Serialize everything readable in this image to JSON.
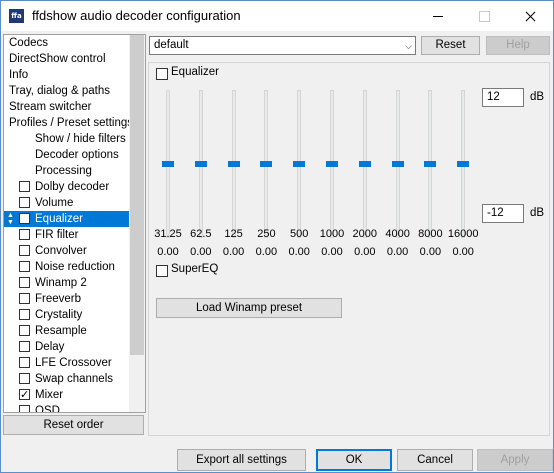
{
  "window": {
    "title": "ffdshow audio decoder configuration",
    "app_icon_text": "ffa",
    "accent": "#0078d7"
  },
  "tree": {
    "items": [
      {
        "label": "Codecs",
        "indent": 0,
        "checkbox": false,
        "checked": false,
        "selected": false
      },
      {
        "label": "DirectShow control",
        "indent": 0,
        "checkbox": false,
        "checked": false,
        "selected": false
      },
      {
        "label": "Info",
        "indent": 0,
        "checkbox": false,
        "checked": false,
        "selected": false
      },
      {
        "label": "Tray, dialog & paths",
        "indent": 0,
        "checkbox": false,
        "checked": false,
        "selected": false
      },
      {
        "label": "Stream switcher",
        "indent": 0,
        "checkbox": false,
        "checked": false,
        "selected": false
      },
      {
        "label": "Profiles / Preset settings",
        "indent": 0,
        "checkbox": false,
        "checked": false,
        "selected": false
      },
      {
        "label": "Show / hide filters",
        "indent": 2,
        "checkbox": false,
        "checked": false,
        "selected": false
      },
      {
        "label": "Decoder options",
        "indent": 2,
        "checkbox": false,
        "checked": false,
        "selected": false
      },
      {
        "label": "Processing",
        "indent": 2,
        "checkbox": false,
        "checked": false,
        "selected": false
      },
      {
        "label": "Dolby decoder",
        "indent": 1,
        "checkbox": true,
        "checked": false,
        "selected": false
      },
      {
        "label": "Volume",
        "indent": 1,
        "checkbox": true,
        "checked": false,
        "selected": false
      },
      {
        "label": "Equalizer",
        "indent": 1,
        "checkbox": true,
        "checked": false,
        "selected": true
      },
      {
        "label": "FIR filter",
        "indent": 1,
        "checkbox": true,
        "checked": false,
        "selected": false
      },
      {
        "label": "Convolver",
        "indent": 1,
        "checkbox": true,
        "checked": false,
        "selected": false
      },
      {
        "label": "Noise reduction",
        "indent": 1,
        "checkbox": true,
        "checked": false,
        "selected": false
      },
      {
        "label": "Winamp 2",
        "indent": 1,
        "checkbox": true,
        "checked": false,
        "selected": false
      },
      {
        "label": "Freeverb",
        "indent": 1,
        "checkbox": true,
        "checked": false,
        "selected": false
      },
      {
        "label": "Crystality",
        "indent": 1,
        "checkbox": true,
        "checked": false,
        "selected": false
      },
      {
        "label": "Resample",
        "indent": 1,
        "checkbox": true,
        "checked": false,
        "selected": false
      },
      {
        "label": "Delay",
        "indent": 1,
        "checkbox": true,
        "checked": false,
        "selected": false
      },
      {
        "label": "LFE Crossover",
        "indent": 1,
        "checkbox": true,
        "checked": false,
        "selected": false
      },
      {
        "label": "Swap channels",
        "indent": 1,
        "checkbox": true,
        "checked": false,
        "selected": false
      },
      {
        "label": "Mixer",
        "indent": 1,
        "checkbox": true,
        "checked": true,
        "selected": false
      },
      {
        "label": "OSD",
        "indent": 1,
        "checkbox": true,
        "checked": false,
        "selected": false
      }
    ],
    "reset_order_label": "Reset order"
  },
  "preset": {
    "selected": "default",
    "reset_label": "Reset",
    "help_label": "Help"
  },
  "equalizer": {
    "enable_label": "Equalizer",
    "enabled": false,
    "max_db": "12",
    "min_db": "-12",
    "db_unit": "dB",
    "bands": [
      {
        "freq": "31.25",
        "value": "0.00",
        "level": 0.5
      },
      {
        "freq": "62.5",
        "value": "0.00",
        "level": 0.5
      },
      {
        "freq": "125",
        "value": "0.00",
        "level": 0.5
      },
      {
        "freq": "250",
        "value": "0.00",
        "level": 0.5
      },
      {
        "freq": "500",
        "value": "0.00",
        "level": 0.5
      },
      {
        "freq": "1000",
        "value": "0.00",
        "level": 0.5
      },
      {
        "freq": "2000",
        "value": "0.00",
        "level": 0.5
      },
      {
        "freq": "4000",
        "value": "0.00",
        "level": 0.5
      },
      {
        "freq": "8000",
        "value": "0.00",
        "level": 0.5
      },
      {
        "freq": "16000",
        "value": "0.00",
        "level": 0.5
      }
    ],
    "supereq_label": "SuperEQ",
    "supereq_checked": false,
    "load_preset_label": "Load Winamp preset"
  },
  "footer": {
    "export_label": "Export all settings",
    "ok_label": "OK",
    "cancel_label": "Cancel",
    "apply_label": "Apply"
  }
}
